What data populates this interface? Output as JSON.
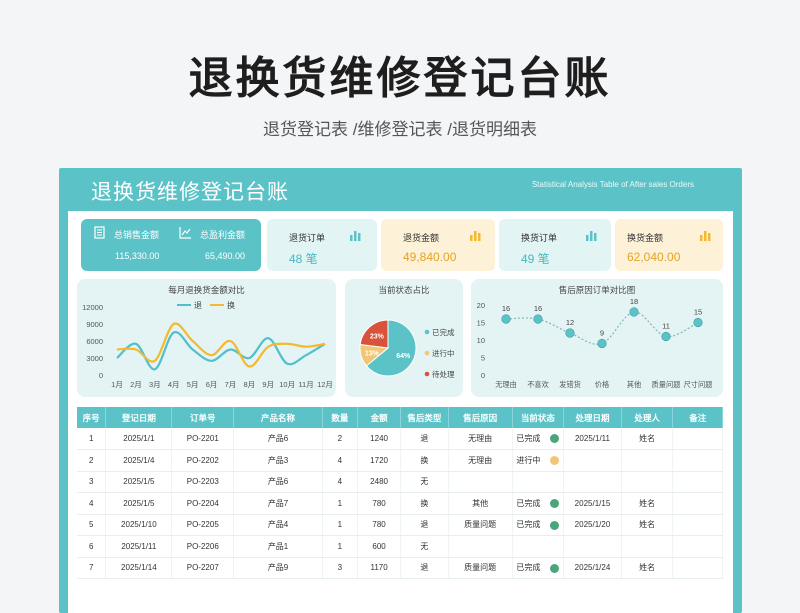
{
  "page": {
    "title": "退换货维修登记台账",
    "subtitle": "退货登记表 /维修登记表 /退货明细表"
  },
  "header": {
    "title": "退换货维修登记台账",
    "en": "Statistical Analysis Table of After sales Orders"
  },
  "kpi": {
    "sales_label": "总销售金额",
    "sales_value": "115,330.00",
    "profit_label": "总盈利金额",
    "profit_value": "65,490.00",
    "return_orders_label": "退货订单",
    "return_orders_value": "48 笔",
    "return_amount_label": "退货金额",
    "return_amount_value": "49,840.00",
    "exchange_orders_label": "换货订单",
    "exchange_orders_value": "49 笔",
    "exchange_amount_label": "换货金额",
    "exchange_amount_value": "62,040.00"
  },
  "colors": {
    "teal": "#5bc3c8",
    "orange": "#f5b82e",
    "red": "#d9533c",
    "green": "#4aa57a",
    "yellow": "#f1c777",
    "line_blue": "#52bfca"
  },
  "chart_data": [
    {
      "type": "line",
      "title": "每月退换货金额对比",
      "categories": [
        "1月",
        "2月",
        "3月",
        "4月",
        "5月",
        "6月",
        "7月",
        "8月",
        "9月",
        "10月",
        "11月",
        "12月"
      ],
      "series": [
        {
          "name": "退",
          "values": [
            3000,
            5500,
            1000,
            7500,
            4500,
            2500,
            4500,
            3000,
            6500,
            2000,
            3500,
            5500
          ]
        },
        {
          "name": "换",
          "values": [
            4500,
            4500,
            2500,
            9000,
            6000,
            3500,
            6000,
            1500,
            5000,
            5500,
            5000,
            5500
          ]
        }
      ],
      "ylim": [
        0,
        12000
      ],
      "yticks": [
        "12000",
        "9000",
        "6000",
        "3000",
        "0"
      ],
      "legend": "top"
    },
    {
      "type": "pie",
      "title": "当前状态占比",
      "labels": [
        "已完成",
        "进行中",
        "待处理"
      ],
      "values": [
        64,
        13,
        23
      ],
      "value_labels": [
        "64%",
        "13%",
        "23%"
      ],
      "legend": "right"
    },
    {
      "type": "line",
      "title": "售后原因订单对比图",
      "categories": [
        "无理由",
        "不喜欢",
        "发错货",
        "价格",
        "其他",
        "质量问题",
        "尺寸问题"
      ],
      "values": [
        16,
        16,
        12,
        9,
        18,
        11,
        15
      ],
      "ylim": [
        0,
        20
      ],
      "yticks": [
        "20",
        "15",
        "10",
        "5",
        "0"
      ]
    }
  ],
  "table": {
    "headers": [
      "序号",
      "登记日期",
      "订单号",
      "产品名称",
      "数量",
      "金额",
      "售后类型",
      "售后原因",
      "当前状态",
      "处理日期",
      "处理人",
      "备注"
    ],
    "rows": [
      {
        "no": "1",
        "date": "2025/1/1",
        "order": "PO-2201",
        "product": "产品6",
        "qty": "2",
        "amount": "1240",
        "type": "退",
        "reason": "无理由",
        "status": "已完成",
        "dot": "#4aa57a",
        "pdate": "2025/1/11",
        "handler": "姓名",
        "note": ""
      },
      {
        "no": "2",
        "date": "2025/1/4",
        "order": "PO-2202",
        "product": "产品3",
        "qty": "4",
        "amount": "1720",
        "type": "换",
        "reason": "无理由",
        "status": "进行中",
        "dot": "#f1c777",
        "pdate": "",
        "handler": "",
        "note": ""
      },
      {
        "no": "3",
        "date": "2025/1/5",
        "order": "PO-2203",
        "product": "产品6",
        "qty": "4",
        "amount": "2480",
        "type": "无",
        "reason": "",
        "status": "",
        "dot": "",
        "pdate": "",
        "handler": "",
        "note": ""
      },
      {
        "no": "4",
        "date": "2025/1/5",
        "order": "PO-2204",
        "product": "产品7",
        "qty": "1",
        "amount": "780",
        "type": "换",
        "reason": "其他",
        "status": "已完成",
        "dot": "#4aa57a",
        "pdate": "2025/1/15",
        "handler": "姓名",
        "note": ""
      },
      {
        "no": "5",
        "date": "2025/1/10",
        "order": "PO-2205",
        "product": "产品4",
        "qty": "1",
        "amount": "780",
        "type": "退",
        "reason": "质量问题",
        "status": "已完成",
        "dot": "#4aa57a",
        "pdate": "2025/1/20",
        "handler": "姓名",
        "note": ""
      },
      {
        "no": "6",
        "date": "2025/1/11",
        "order": "PO-2206",
        "product": "产品1",
        "qty": "1",
        "amount": "600",
        "type": "无",
        "reason": "",
        "status": "",
        "dot": "",
        "pdate": "",
        "handler": "",
        "note": ""
      },
      {
        "no": "7",
        "date": "2025/1/14",
        "order": "PO-2207",
        "product": "产品9",
        "qty": "3",
        "amount": "1170",
        "type": "退",
        "reason": "质量问题",
        "status": "已完成",
        "dot": "#4aa57a",
        "pdate": "2025/1/24",
        "handler": "姓名",
        "note": ""
      }
    ]
  }
}
